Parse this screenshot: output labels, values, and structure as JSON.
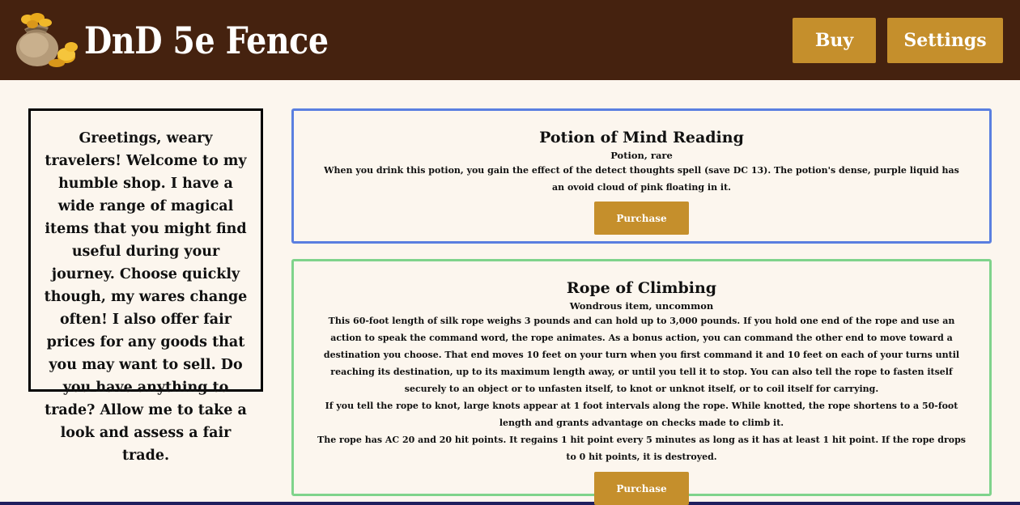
{
  "header": {
    "title": "DnD 5e Fence",
    "logo_icon": "coin-bag-icon",
    "nav": {
      "buy_label": "Buy",
      "settings_label": "Settings"
    }
  },
  "greeting": {
    "text": "Greetings, weary travelers! Welcome to my humble shop. I have a wide range of magical items that you might find useful during your journey. Choose quickly though, my wares change often! I also offer fair prices for any goods that you may want to sell. Do you have anything to trade? Allow me to take a look and assess a fair trade."
  },
  "items": [
    {
      "name": "Potion of Mind Reading",
      "type": "Potion, rare",
      "description": [
        "When you drink this potion, you gain the effect of the detect thoughts spell (save DC 13). The potion's dense, purple liquid has an ovoid cloud of pink floating in it."
      ],
      "purchase_label": "Purchase"
    },
    {
      "name": "Rope of Climbing",
      "type": "Wondrous item, uncommon",
      "description": [
        "This 60-foot length of silk rope weighs 3 pounds and can hold up to 3,000 pounds. If you hold one end of the rope and use an action to speak the command word, the rope animates. As a bonus action, you can command the other end to move toward a destination you choose. That end moves 10 feet on your turn when you first command it and 10 feet on each of your turns until reaching its destination, up to its maximum length away, or until you tell it to stop. You can also tell the rope to fasten itself securely to an object or to unfasten itself, to knot or unknot itself, or to coil itself for carrying.",
        "If you tell the rope to knot, large knots appear at 1 foot intervals along the rope. While knotted, the rope shortens to a 50-foot length and grants advantage on checks made to climb it.",
        "The rope has AC 20 and 20 hit points. It regains 1 hit point every 5 minutes as long as it has at least 1 hit point. If the rope drops to 0 hit points, it is destroyed."
      ],
      "purchase_label": "Purchase"
    }
  ],
  "colors": {
    "header_bg": "#45220f",
    "accent_gold": "#c58f2c",
    "page_bg": "#fcf6ee",
    "card1_border": "#5a7fe0",
    "card2_border": "#7fd38b"
  }
}
